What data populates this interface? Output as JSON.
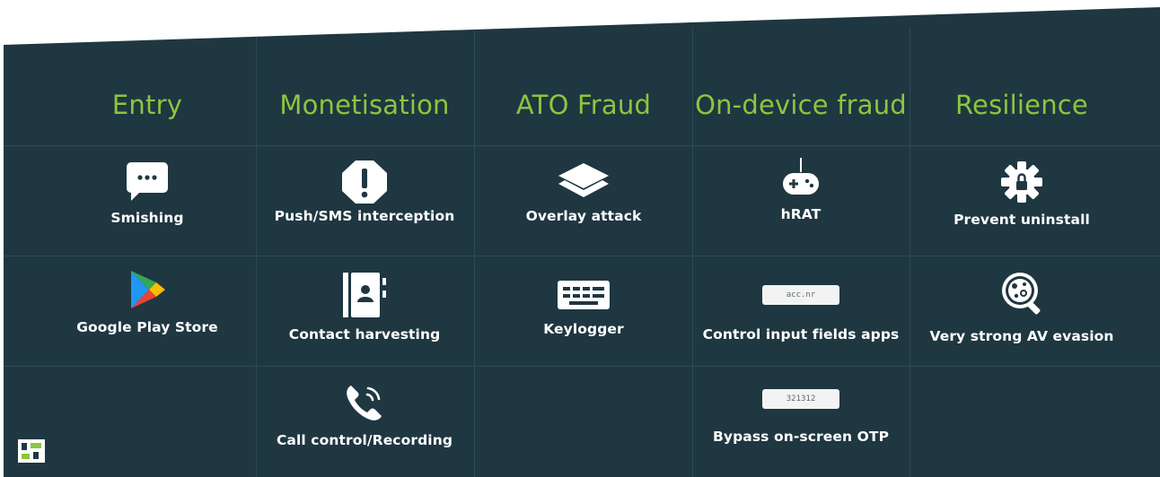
{
  "colors": {
    "background": "#1f3741",
    "accent": "#8cc63f",
    "grid": "#2d4b55",
    "text": "#ffffff"
  },
  "columns": [
    {
      "header": "Entry",
      "items": [
        {
          "icon": "chat-bubble-icon",
          "label": "Smishing"
        },
        {
          "icon": "google-play-icon",
          "label": "Google Play Store"
        }
      ]
    },
    {
      "header": "Monetisation",
      "items": [
        {
          "icon": "exclamation-octagon-icon",
          "label": "Push/SMS interception"
        },
        {
          "icon": "contact-book-icon",
          "label": "Contact harvesting"
        },
        {
          "icon": "phone-call-icon",
          "label": "Call control/Recording"
        }
      ]
    },
    {
      "header": "ATO Fraud",
      "items": [
        {
          "icon": "layers-icon",
          "label": "Overlay attack"
        },
        {
          "icon": "keyboard-icon",
          "label": "Keylogger"
        }
      ]
    },
    {
      "header": "On-device fraud",
      "items": [
        {
          "icon": "game-controller-icon",
          "label": "hRAT"
        },
        {
          "icon": "input-field-icon",
          "field_text": "acc.nr",
          "label": "Control input fields apps"
        },
        {
          "icon": "otp-field-icon",
          "field_text": "321312",
          "label": "Bypass on-screen OTP"
        }
      ]
    },
    {
      "header": "Resilience",
      "items": [
        {
          "icon": "gear-lock-icon",
          "label": "Prevent uninstall"
        },
        {
          "icon": "virus-magnifier-icon",
          "label": "Very strong AV evasion"
        }
      ]
    }
  ],
  "logo": {
    "icon": "brand-logo-icon"
  }
}
